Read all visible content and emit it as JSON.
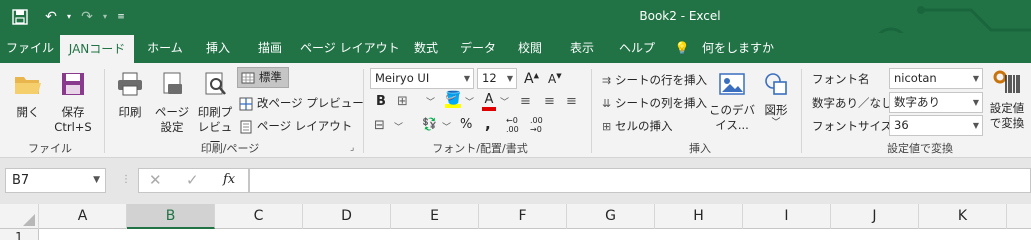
{
  "window": {
    "title": "Book2  -  Excel"
  },
  "tabs": [
    {
      "label": "ファイル",
      "active": false
    },
    {
      "label": "JANコード",
      "active": true
    },
    {
      "label": "ホーム",
      "active": false
    },
    {
      "label": "挿入",
      "active": false
    },
    {
      "label": "描画",
      "active": false
    },
    {
      "label": "ページ レイアウト",
      "active": false
    },
    {
      "label": "数式",
      "active": false
    },
    {
      "label": "データ",
      "active": false
    },
    {
      "label": "校閲",
      "active": false
    },
    {
      "label": "表示",
      "active": false
    },
    {
      "label": "ヘルプ",
      "active": false
    },
    {
      "label": "何をしますか",
      "active": false
    }
  ],
  "ribbon": {
    "file_group": {
      "open_label": "開く",
      "save_label": "保存\nCtrl+S",
      "group_label": "ファイル"
    },
    "print_group": {
      "print_label": "印刷",
      "page_setup_label": "ページ\n設定",
      "print_preview_label": "印刷プ\nレビュー",
      "normal_label": "標準",
      "page_break_label": "改ページ プレビュー",
      "page_layout_label": "ページ レイアウト",
      "group_label": "印刷/ページ"
    },
    "font_group": {
      "font_name": "Meiryo UI",
      "font_size": "12",
      "percent_symbol": "%",
      "comma_symbol": ",",
      "group_label": "フォント/配置/書式"
    },
    "insert_group": {
      "insert_row_label": "シートの行を挿入",
      "insert_col_label": "シートの列を挿入",
      "insert_cell_label": "セルの挿入",
      "device_label": "このデバ\nイス...",
      "shapes_label": "図形",
      "group_label": "挿入"
    },
    "settings_group": {
      "font_name_label": "フォント名",
      "font_name_value": "nicotan",
      "numeric_label": "数字あり／なし",
      "numeric_value": "数字あり",
      "font_size_label": "フォントサイズ",
      "font_size_value": "36",
      "convert_label": "設定値\nで変換",
      "group_label": "設定値で変換"
    }
  },
  "formula_bar": {
    "name_box": "B7",
    "fx_label": "fx",
    "formula": ""
  },
  "grid": {
    "columns": [
      "A",
      "B",
      "C",
      "D",
      "E",
      "F",
      "G",
      "H",
      "I",
      "J",
      "K"
    ],
    "selected_column": "B",
    "rows": [
      "1"
    ]
  },
  "colors": {
    "accent": "#217346",
    "ribbon_bg": "#f3f3f3"
  }
}
